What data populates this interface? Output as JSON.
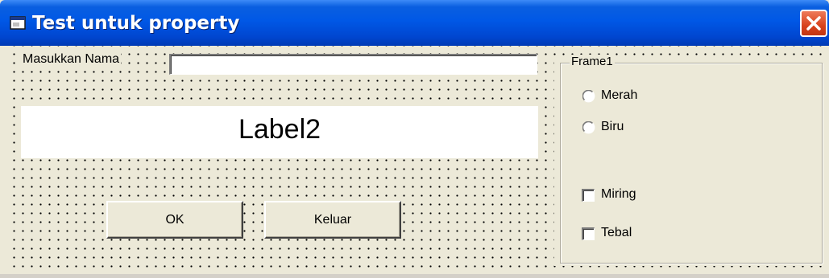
{
  "window": {
    "title": "Test untuk property",
    "colors": {
      "titlebar": "#0058e6",
      "close": "#d8421c",
      "face": "#ece9d8"
    },
    "icons": {
      "app": "form-icon",
      "close": "close-icon"
    }
  },
  "form": {
    "name_label": "Masukkan Nama",
    "name_value": "",
    "display_label": "Label2",
    "ok_button": "OK",
    "exit_button": "Keluar"
  },
  "frame": {
    "title": "Frame1",
    "radios": [
      {
        "label": "Merah",
        "checked": false
      },
      {
        "label": "Biru",
        "checked": false
      }
    ],
    "checkboxes": [
      {
        "label": "Miring",
        "checked": false
      },
      {
        "label": "Tebal",
        "checked": false
      }
    ]
  }
}
